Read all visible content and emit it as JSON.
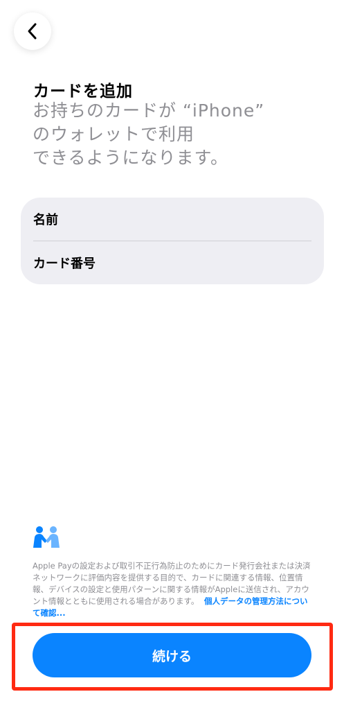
{
  "header": {
    "back_icon": "chevron-left-icon",
    "title": "カードを追加",
    "subtitle": "お持ちのカードが “iPhone”\nのウォレットで利用\nできるようになります。"
  },
  "form": {
    "name_label": "名前",
    "name_value": "",
    "card_number_label": "カード番号",
    "card_number_value": ""
  },
  "privacy": {
    "icon": "privacy-handshake-icon",
    "text": "Apple Payの設定および取引不正行為防止のためにカード発行会社または決済ネットワークに評価内容を提供する目的で、カードに関連する情報、位置情報、デバイスの設定と使用パターンに関する情報がAppleに送信され、アカウント情報とともに使用される場合があります。",
    "link": "個人データの管理方法について確認..."
  },
  "footer": {
    "continue_label": "続ける"
  },
  "colors": {
    "accent": "#0a84ff",
    "highlight": "#ff2a12",
    "form_background": "#eeeef3",
    "secondary_text": "#8e8e93"
  }
}
